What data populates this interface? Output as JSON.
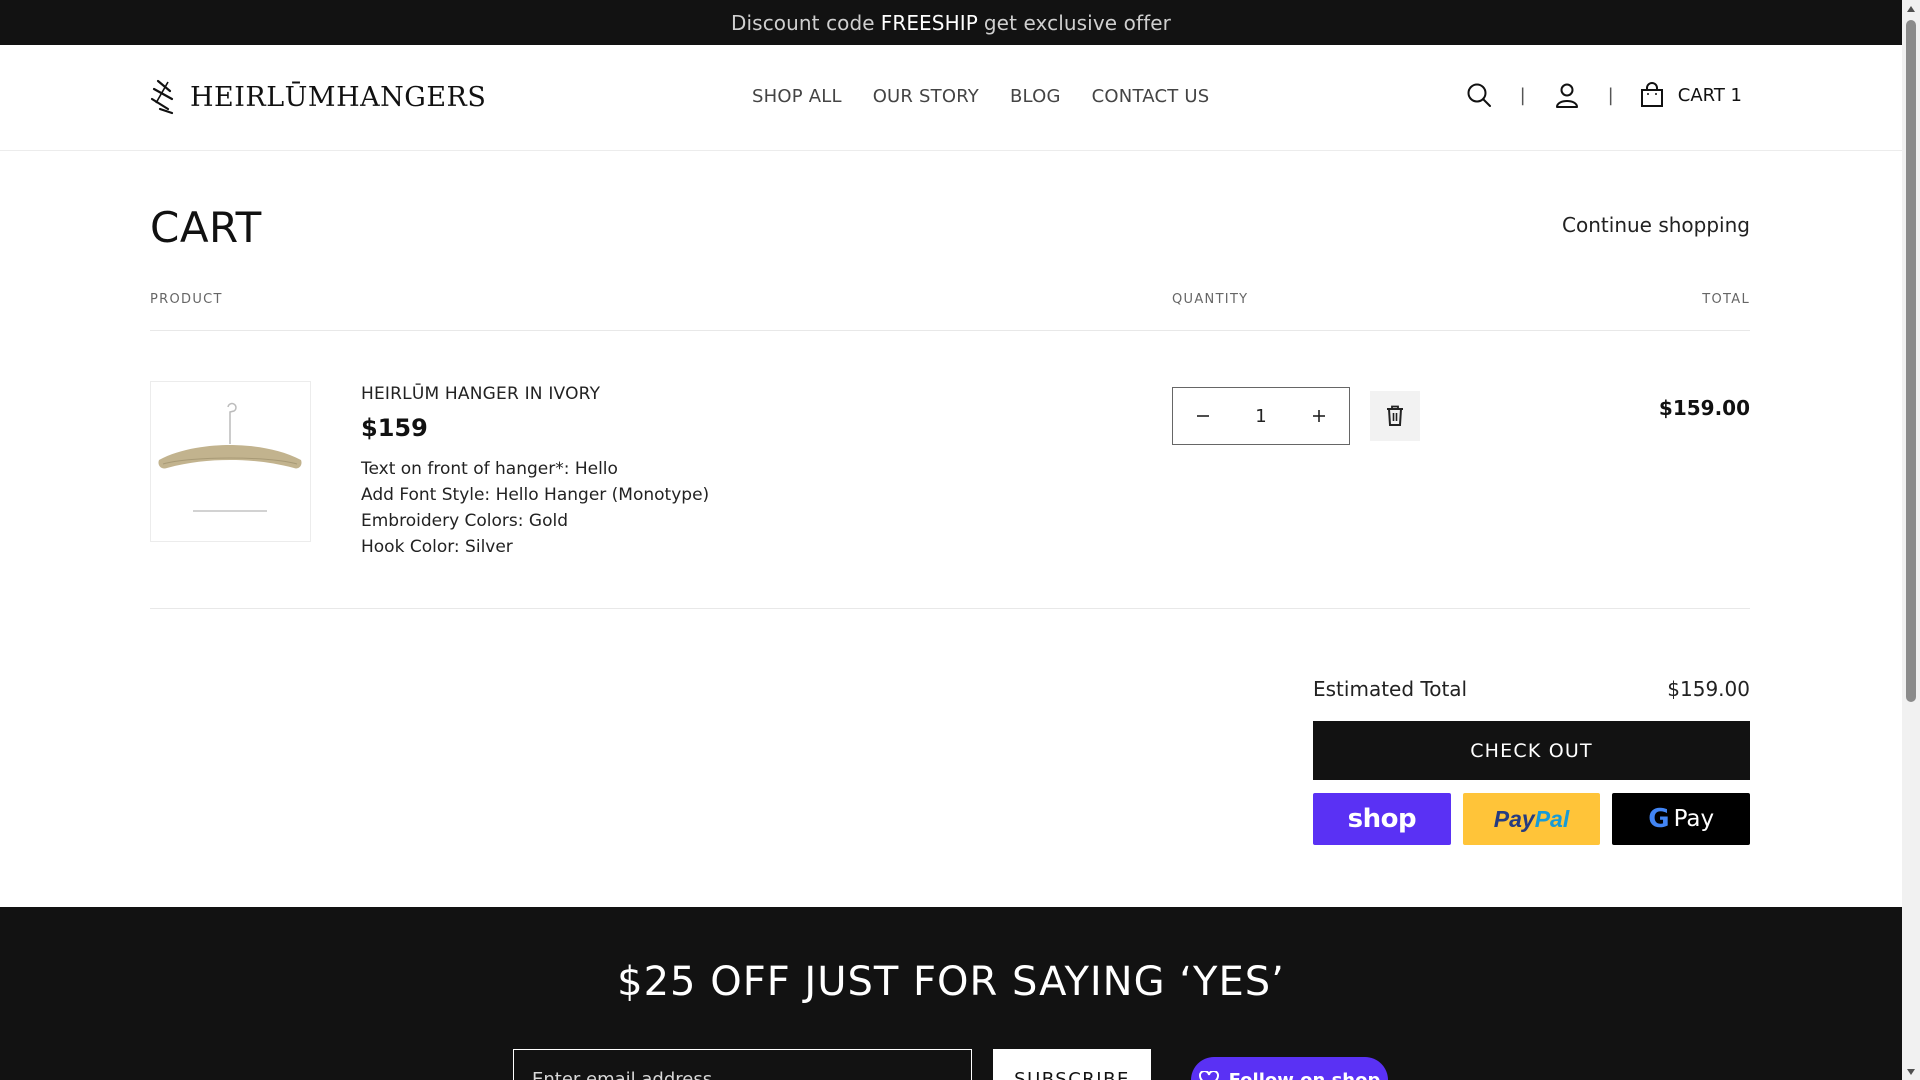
{
  "announcement": {
    "prefix": "Discount code",
    "code": "FREESHIP",
    "suffix": "get exclusive offer"
  },
  "header": {
    "logo_text": "HEIRLŪMHANGERS",
    "nav": [
      "SHOP ALL",
      "OUR STORY",
      "BLOG",
      "CONTACT US"
    ],
    "separator": "|",
    "cart_label": "CART 1",
    "icons": [
      "search-icon",
      "account-icon",
      "cart-bag-icon"
    ]
  },
  "cart": {
    "title": "CART",
    "continue_label": "Continue shopping",
    "columns": {
      "product": "PRODUCT",
      "quantity": "QUANTITY",
      "total": "TOTAL"
    },
    "item": {
      "name": "HEIRLŪM HANGER IN IVORY",
      "price": "$159",
      "options": [
        "Text on front of hanger*: Hello",
        "Add Font Style: Hello Hanger (Monotype)",
        "Embroidery Colors: Gold",
        "Hook Color: Silver"
      ],
      "quantity": "1",
      "line_total": "$159.00"
    },
    "summary": {
      "estimated_label": "Estimated Total",
      "estimated_value": "$159.00",
      "checkout_label": "CHECK OUT"
    },
    "wallets": {
      "shop": "shop",
      "paypal_a": "Pay",
      "paypal_b": "Pal",
      "gpay_g": "G",
      "gpay_text": "Pay"
    }
  },
  "footer": {
    "title": "$25 OFF JUST FOR SAYING ‘YES’",
    "email_placeholder": "Enter email address",
    "subscribe_label": "SUBSCRIBE",
    "follow_label": "Follow on shop"
  },
  "colors": {
    "dark": "#121212",
    "shop_purple": "#5a31f4",
    "paypal_yellow": "#ffc439"
  }
}
